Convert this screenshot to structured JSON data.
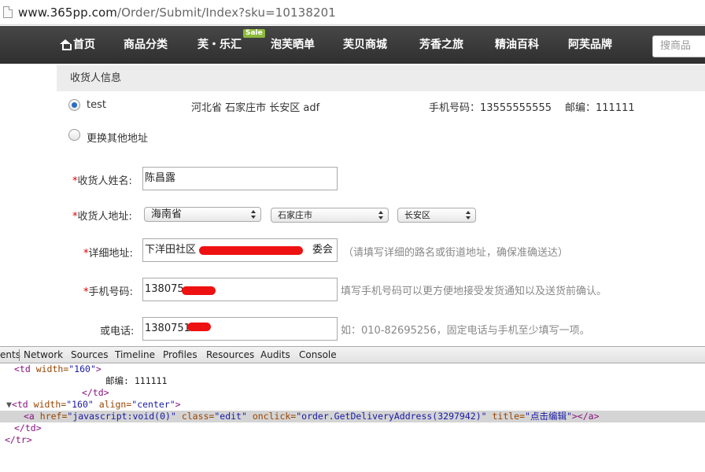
{
  "browser": {
    "url_host": "www.365pp.com",
    "url_path": "/Order/Submit/Index?sku=10138201"
  },
  "nav": {
    "items": [
      "首页",
      "商品分类",
      "芙・乐汇",
      "泡芙晒单",
      "芙贝商城",
      "芳香之旅",
      "精油百科",
      "阿芙品牌"
    ],
    "sale_badge": "Sale",
    "search_placeholder": "搜商品"
  },
  "section": {
    "title": "收货人信息"
  },
  "saved_address": {
    "name": "test",
    "address": "河北省 石家庄市 长安区 adf",
    "phone": "手机号码：13555555555",
    "zip": "邮编：111111",
    "selected": true
  },
  "other_address": {
    "label": "更换其他地址"
  },
  "form": {
    "name_label": "收货人姓名:",
    "name_value": "陈昌露",
    "address_label": "收货人地址:",
    "province": "海南省",
    "city": "石家庄市",
    "district": "长安区",
    "detail_label": "详细地址:",
    "detail_prefix": "下洋田社区",
    "detail_suffix": "委会",
    "detail_hint": "（请填写详细的路名或街道地址，确保准确送达）",
    "mobile_label": "手机号码:",
    "mobile_value": "138075",
    "mobile_hint": "填写手机号码可以更方便地接受发货通知以及送货前确认。",
    "tel_label": "或电话:",
    "tel_value": "1380751",
    "tel_hint": "如：010-82695256，固定电话与手机至少填写一项。",
    "required_mark": "*"
  },
  "devtools": {
    "tabs": [
      "ents",
      "Network",
      "Sources",
      "Timeline",
      "Profiles",
      "Resources",
      "Audits",
      "Console"
    ],
    "lines": {
      "l1_open": "<td",
      "l1_attr": " width=",
      "l1_val": "\"160\"",
      "l1_close": ">",
      "l2_text": "邮编: 111111",
      "l3": "</td>",
      "l4_tri": "▼",
      "l4_open": "<td",
      "l4_attr1": " width=",
      "l4_val1": "\"160\"",
      "l4_attr2": " align=",
      "l4_val2": "\"center\"",
      "l4_close": ">",
      "l5_open": "<a",
      "l5_attr1": " href=",
      "l5_val1": "\"javascript:void(0)\"",
      "l5_attr2": " class=",
      "l5_val2": "\"edit\"",
      "l5_attr3": " onclick=",
      "l5_val3": "\"order.GetDeliveryAddress(3297942)\"",
      "l5_attr4": " title=",
      "l5_val4": "\"点击编辑\"",
      "l5_close": "></a>",
      "l6": "</td>",
      "l7": "</tr>"
    }
  },
  "colors": {
    "nav_bg": "#3a3a3a",
    "required": "#dd0000",
    "sale_badge": "#8cb93b",
    "redaction": "#ee1111"
  }
}
